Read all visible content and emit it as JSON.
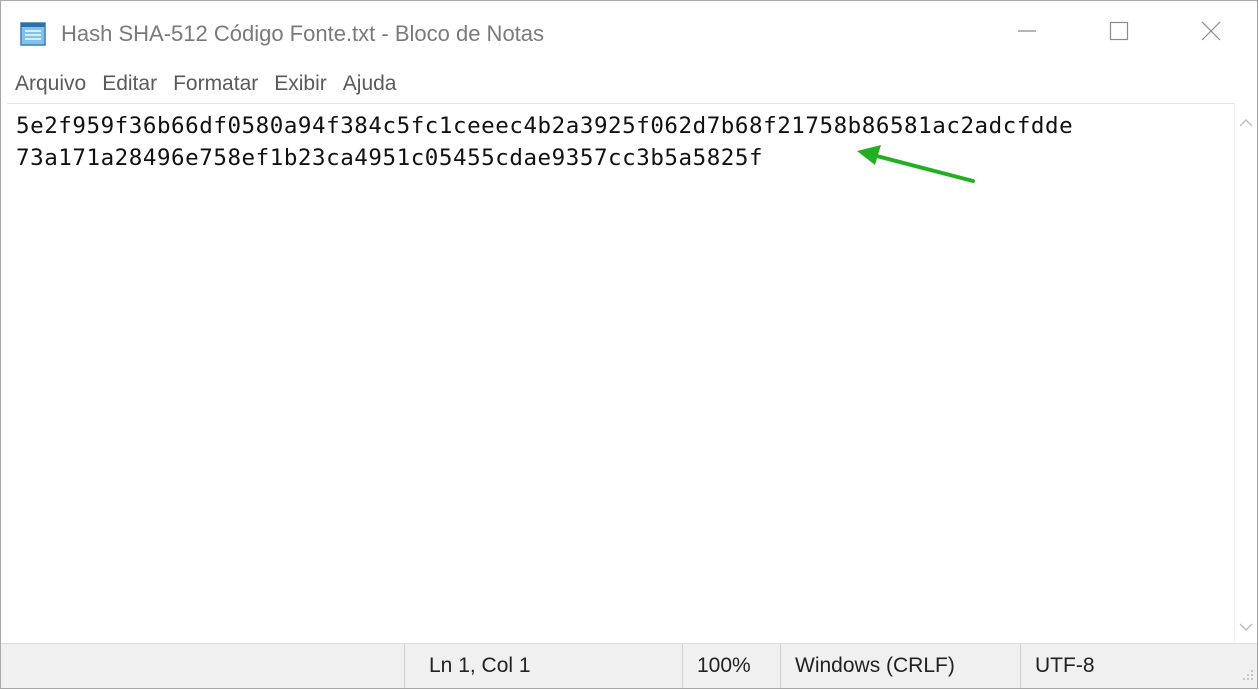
{
  "window": {
    "title": "Hash SHA-512 Código Fonte.txt - Bloco de Notas",
    "app_icon": "notepad-icon",
    "controls": [
      "minimize-icon",
      "maximize-icon",
      "close-icon"
    ]
  },
  "menu": {
    "items": [
      "Arquivo",
      "Editar",
      "Formatar",
      "Exibir",
      "Ajuda"
    ]
  },
  "editor": {
    "lines": [
      "5e2f959f36b66df0580a94f384c5fc1ceeec4b2a3925f062d7b68f21758b86581ac2adcfdde",
      "73a171a28496e758ef1b23ca4951c05455cdae9357cc3b5a5825f"
    ],
    "annotation": {
      "icon": "green-arrow-icon",
      "color": "#22b022"
    }
  },
  "status": {
    "position": "Ln 1, Col 1",
    "zoom": "100%",
    "line_ending": "Windows (CRLF)",
    "encoding": "UTF-8"
  }
}
